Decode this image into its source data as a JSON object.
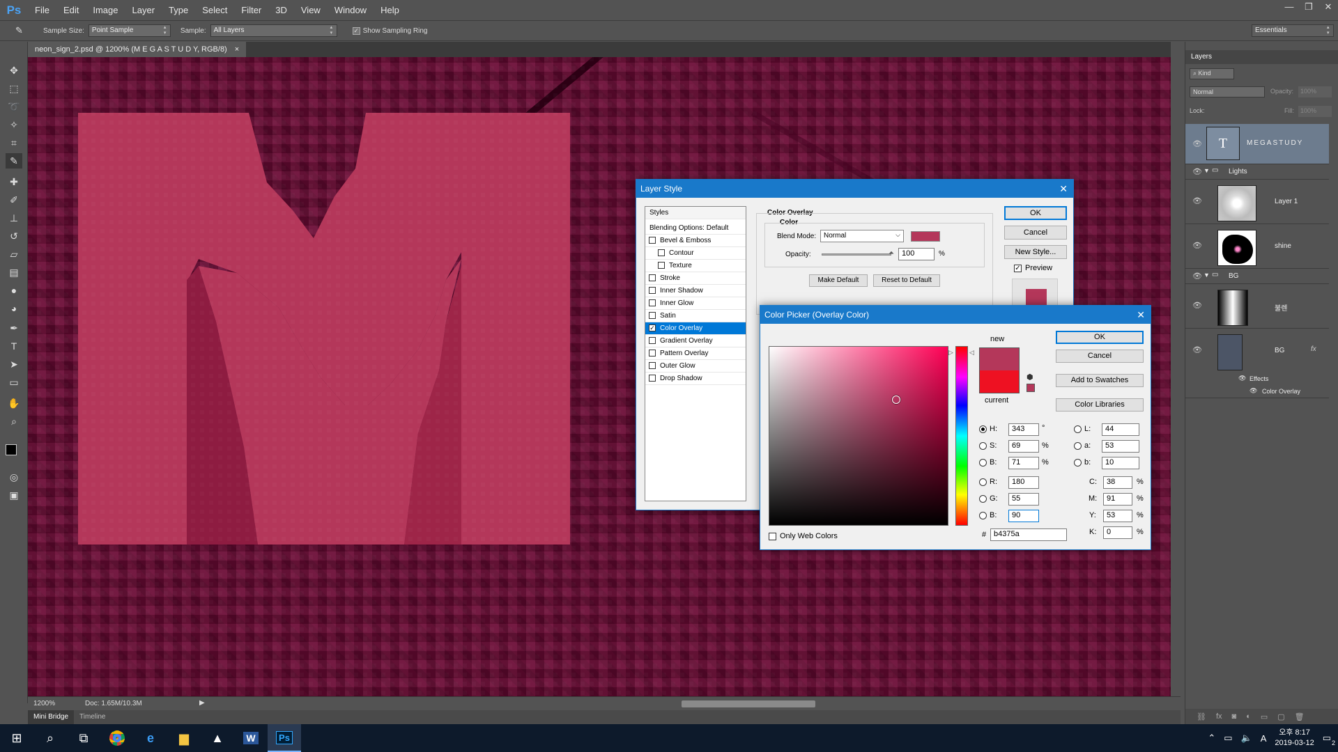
{
  "app": {
    "logo": "Ps"
  },
  "menu": [
    "File",
    "Edit",
    "Image",
    "Layer",
    "Type",
    "Select",
    "Filter",
    "3D",
    "View",
    "Window",
    "Help"
  ],
  "window_controls": [
    "—",
    "❐",
    "✕"
  ],
  "options": {
    "sample_size_label": "Sample Size:",
    "sample_size_value": "Point Sample",
    "sample_label": "Sample:",
    "sample_value": "All Layers",
    "show_ring_label": "Show Sampling Ring",
    "workspace": "Essentials"
  },
  "document": {
    "tab_title": "neon_sign_2.psd @ 1200% (M E G A S T U D Y, RGB/8)",
    "tab_close": "×",
    "zoom": "1200%",
    "doc_size": "Doc: 1.65M/10.3M"
  },
  "bottom_tabs": [
    "Mini Bridge",
    "Timeline"
  ],
  "layers_panel": {
    "title": "Layers",
    "kind_filter": "Kind",
    "blend": "Normal",
    "opacity_label": "Opacity:",
    "opacity_value": "100%",
    "lock_label": "Lock:",
    "fill_label": "Fill:",
    "fill_value": "100%",
    "layers": [
      {
        "name": "MEGASTUDY",
        "type": "text"
      },
      {
        "name": "Lights",
        "type": "group"
      },
      {
        "name": "Layer 1",
        "type": "pixel"
      },
      {
        "name": "shine",
        "type": "pixel"
      },
      {
        "name": "BG",
        "type": "group"
      },
      {
        "name": "불렌",
        "type": "pixel"
      },
      {
        "name": "BG",
        "type": "pixel",
        "fx": "fx"
      },
      {
        "name": "Effects",
        "type": "effects"
      },
      {
        "name": "Color Overlay",
        "type": "effect"
      }
    ]
  },
  "layer_style": {
    "title": "Layer Style",
    "close": "✕",
    "styles_header": "Styles",
    "blending_options": "Blending Options: Default",
    "styles": [
      {
        "label": "Bevel & Emboss",
        "checked": false,
        "indent": false
      },
      {
        "label": "Contour",
        "checked": false,
        "indent": true
      },
      {
        "label": "Texture",
        "checked": false,
        "indent": true
      },
      {
        "label": "Stroke",
        "checked": false,
        "indent": false
      },
      {
        "label": "Inner Shadow",
        "checked": false,
        "indent": false
      },
      {
        "label": "Inner Glow",
        "checked": false,
        "indent": false
      },
      {
        "label": "Satin",
        "checked": false,
        "indent": false
      },
      {
        "label": "Color Overlay",
        "checked": true,
        "indent": false
      },
      {
        "label": "Gradient Overlay",
        "checked": false,
        "indent": false
      },
      {
        "label": "Pattern Overlay",
        "checked": false,
        "indent": false
      },
      {
        "label": "Outer Glow",
        "checked": false,
        "indent": false
      },
      {
        "label": "Drop Shadow",
        "checked": false,
        "indent": false
      }
    ],
    "section_title": "Color Overlay",
    "subsection": "Color",
    "blend_mode_label": "Blend Mode:",
    "blend_mode_value": "Normal",
    "opacity_label": "Opacity:",
    "opacity_value": "100",
    "opacity_unit": "%",
    "make_default": "Make Default",
    "reset_default": "Reset to Default",
    "ok": "OK",
    "cancel": "Cancel",
    "new_style": "New Style...",
    "preview": "Preview",
    "overlay_color": "#b4375a"
  },
  "color_picker": {
    "title": "Color Picker (Overlay Color)",
    "close": "✕",
    "new_label": "new",
    "current_label": "current",
    "new_color": "#b4375a",
    "current_color": "#ee1122",
    "ok": "OK",
    "cancel": "Cancel",
    "add_swatches": "Add to Swatches",
    "color_libraries": "Color Libraries",
    "fields": {
      "H": {
        "label": "H:",
        "value": "343",
        "unit": "°"
      },
      "S": {
        "label": "S:",
        "value": "69",
        "unit": "%"
      },
      "B": {
        "label": "B:",
        "value": "71",
        "unit": "%"
      },
      "R": {
        "label": "R:",
        "value": "180"
      },
      "G": {
        "label": "G:",
        "value": "55"
      },
      "Bl": {
        "label": "B:",
        "value": "90"
      },
      "L": {
        "label": "L:",
        "value": "44"
      },
      "a": {
        "label": "a:",
        "value": "53"
      },
      "b": {
        "label": "b:",
        "value": "10"
      },
      "C": {
        "label": "C:",
        "value": "38",
        "unit": "%"
      },
      "M": {
        "label": "M:",
        "value": "91",
        "unit": "%"
      },
      "Y": {
        "label": "Y:",
        "value": "53",
        "unit": "%"
      },
      "K": {
        "label": "K:",
        "value": "0",
        "unit": "%"
      }
    },
    "hex_label": "#",
    "hex_value": "b4375a",
    "only_web": "Only Web Colors"
  },
  "taskbar": {
    "time": "오후 8:17",
    "date": "2019-03-12",
    "notif": "2",
    "ime": "A"
  },
  "colors": {
    "canvas_bg": "#6a0a34",
    "letter": "#b4375a"
  }
}
